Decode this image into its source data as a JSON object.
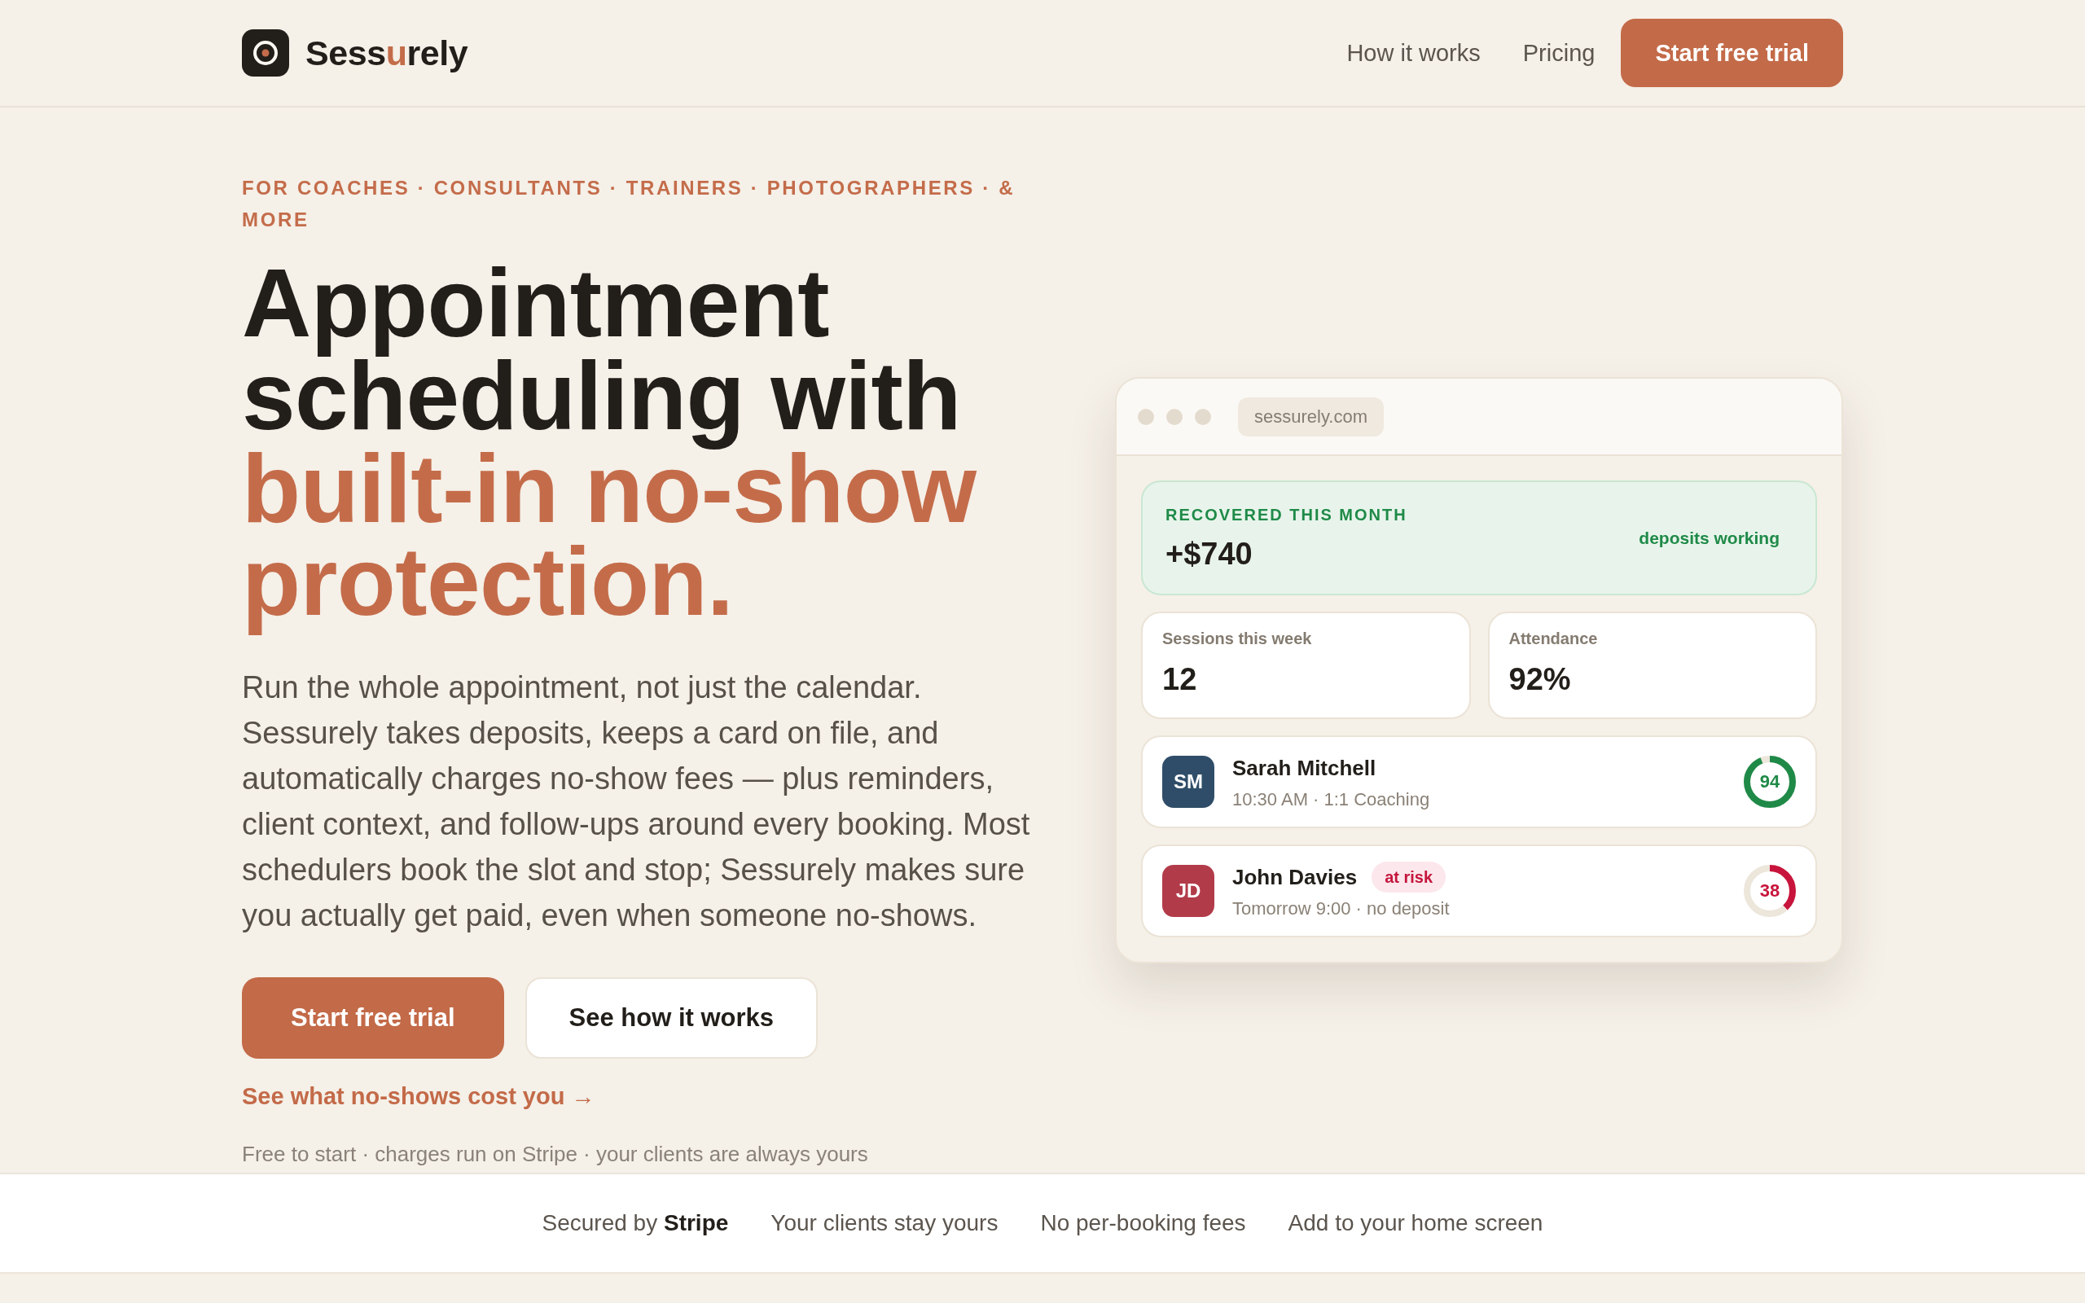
{
  "header": {
    "brand": [
      {
        "text": "Sess",
        "accent": false
      },
      {
        "text": "u",
        "accent": true
      },
      {
        "text": "rely",
        "accent": false
      }
    ],
    "nav": [
      "How it works",
      "Pricing"
    ],
    "cta": "Start free trial"
  },
  "hero": {
    "eyebrow": "FOR COACHES · CONSULTANTS · TRAINERS · PHOTOGRAPHERS · & MORE",
    "heading": {
      "lead": "Appointment scheduling with",
      "accent": "built-in no-show protection."
    },
    "body": "Run the whole appointment, not just the calendar. Sessurely takes deposits, keeps a card on file, and automatically charges no-show fees — plus reminders, client context, and follow-ups around every booking. Most schedulers book the slot and stop; Sessurely makes sure you actually get paid, even when someone no-shows.",
    "buttons": [
      {
        "label": "Start free trial",
        "kind": "primary"
      },
      {
        "label": "See how it works",
        "kind": "secondary"
      }
    ],
    "link": "See what no-shows cost you →",
    "note": "Free to start · charges run on Stripe · your clients are always yours"
  },
  "preview": {
    "url": "sessurely.com",
    "recovered": {
      "label": "RECOVERED THIS MONTH",
      "value": "+$740",
      "status": "deposits working"
    },
    "stats": [
      {
        "label": "Sessions this week",
        "value": "12"
      },
      {
        "label": "Attendance",
        "value": "92%"
      }
    ],
    "clients": [
      {
        "initials": "SM",
        "name": "Sarah Mitchell",
        "detail": "10:30 AM · 1:1 Coaching",
        "color": "#2f4d68",
        "at_risk": false,
        "score": "94",
        "level": 0.94
      },
      {
        "initials": "JD",
        "name": "John Davies",
        "badge": "at risk",
        "detail": "Tomorrow 9:00 · no deposit",
        "color": "#b23b4a",
        "at_risk": true,
        "score": "38",
        "level": 0.38
      }
    ]
  },
  "trust_strip": [
    "Secured by **Stripe**",
    "Your clients stay yours",
    "No per-booking fees",
    "Add to your home screen"
  ]
}
